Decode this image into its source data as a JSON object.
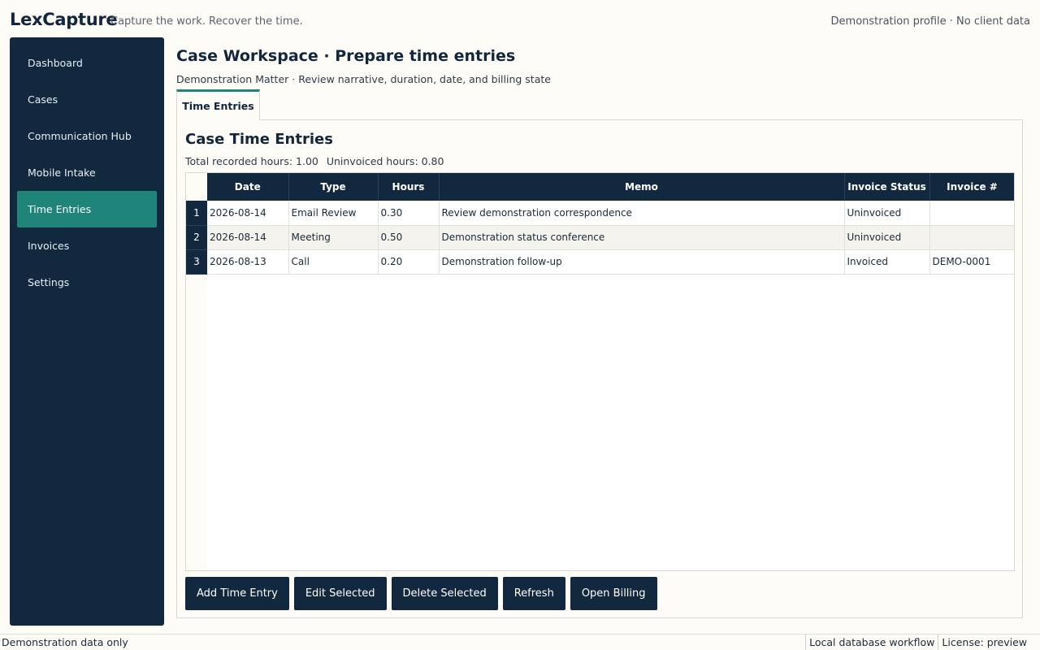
{
  "header": {
    "brand": "LexCapture",
    "tagline": "Capture the work. Recover the time.",
    "profile": "Demonstration profile · No client data"
  },
  "sidebar": {
    "items": [
      {
        "label": "Dashboard"
      },
      {
        "label": "Cases"
      },
      {
        "label": "Communication Hub"
      },
      {
        "label": "Mobile Intake"
      },
      {
        "label": "Time Entries",
        "active": true
      },
      {
        "label": "Invoices"
      },
      {
        "label": "Settings"
      }
    ]
  },
  "main": {
    "title": "Case Workspace · Prepare time entries",
    "subtitle": "Demonstration Matter · Review narrative, duration, date, and billing state",
    "tab": "Time Entries",
    "panel_title": "Case Time Entries",
    "summary": {
      "total": "Total recorded hours: 1.00",
      "uninvoiced": "Uninvoiced hours: 0.80"
    },
    "table": {
      "columns": [
        "Date",
        "Type",
        "Hours",
        "Memo",
        "Invoice Status",
        "Invoice #"
      ],
      "rows": [
        {
          "num": "1",
          "cells": [
            "2026-08-14",
            "Email Review",
            "0.30",
            "Review demonstration correspondence",
            "Uninvoiced",
            ""
          ]
        },
        {
          "num": "2",
          "cells": [
            "2026-08-14",
            "Meeting",
            "0.50",
            "Demonstration status conference",
            "Uninvoiced",
            ""
          ]
        },
        {
          "num": "3",
          "cells": [
            "2026-08-13",
            "Call",
            "0.20",
            "Demonstration follow-up",
            "Invoiced",
            "DEMO-0001"
          ]
        }
      ]
    },
    "buttons": {
      "add": "Add Time Entry",
      "edit": "Edit Selected",
      "delete": "Delete Selected",
      "refresh": "Refresh",
      "billing": "Open Billing"
    }
  },
  "statusbar": {
    "left": "Demonstration data only",
    "workflow": "Local database workflow",
    "license": "License: preview"
  }
}
